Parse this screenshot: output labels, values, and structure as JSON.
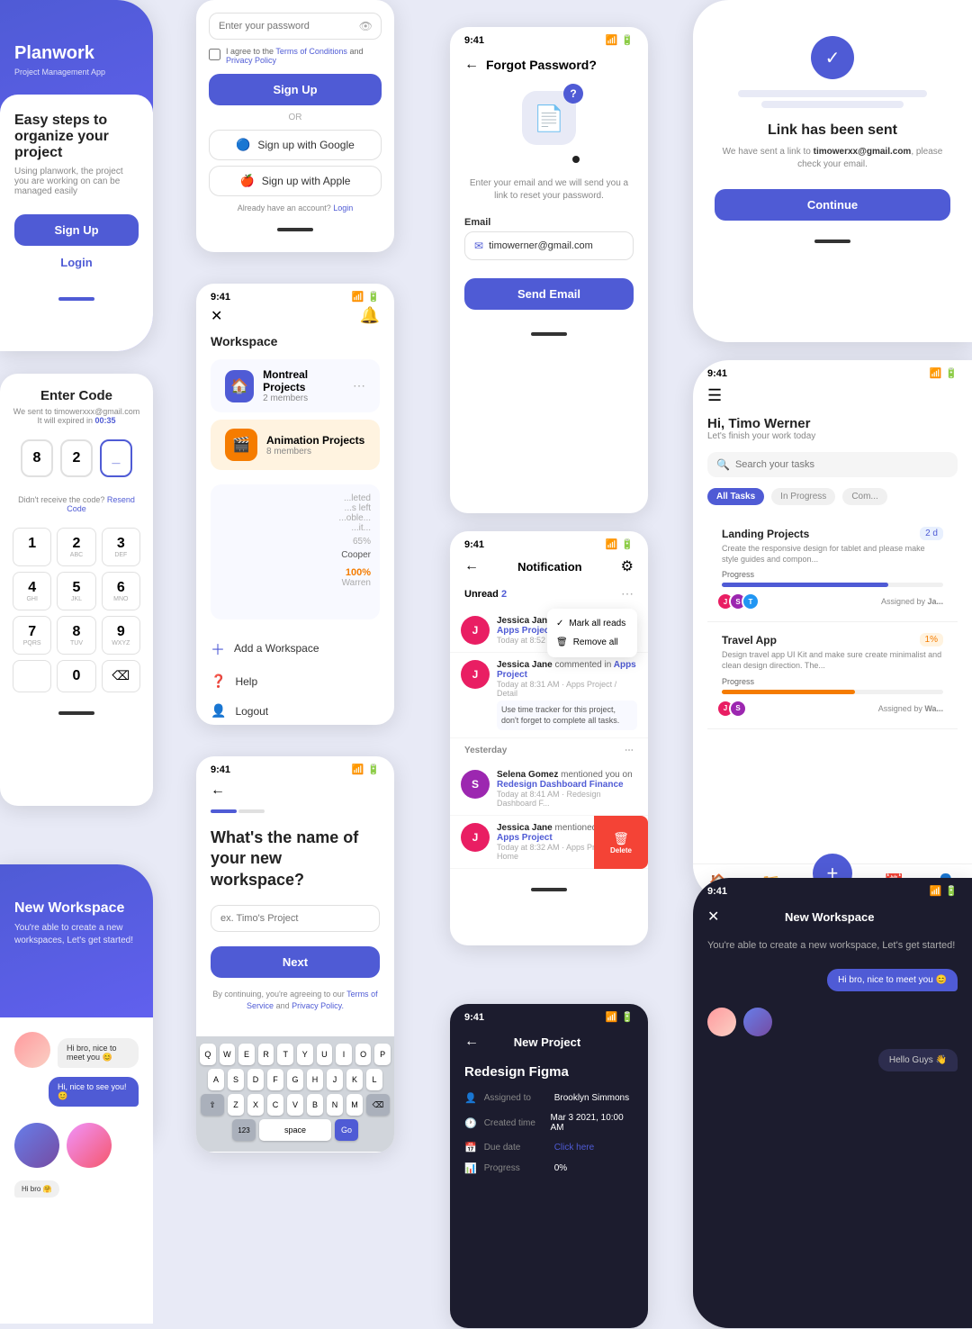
{
  "app": {
    "name": "Planwork",
    "tagline": "Project Management App",
    "description": "Easy steps to organize your project",
    "sub_description": "Using planwork, the project you are working on can be managed easily"
  },
  "signup": {
    "password_placeholder": "Enter your password",
    "terms_label": "I agree to the Terms of Conditions and Privacy Policy",
    "sign_up_btn": "Sign Up",
    "or_label": "OR",
    "google_btn": "Sign up with Google",
    "apple_btn": "Sign up with Apple",
    "login_prompt": "Already have an account?",
    "login_link": "Login"
  },
  "workspace": {
    "title": "Workspace",
    "projects": [
      {
        "name": "Montreal Projects",
        "members": "2 members",
        "color": "#4f5bd5"
      },
      {
        "name": "Animation Projects",
        "members": "8 members",
        "color": "#f57c00"
      }
    ],
    "add_workspace": "Add a Workspace",
    "help": "Help",
    "logout": "Logout"
  },
  "new_workspace_name": {
    "title": "What's the name of your new workspace?",
    "placeholder": "ex. Timo's Project",
    "next_btn": "Next",
    "terms_text": "By continuing, you're agreeing to our Terms of Service and Privacy Policy."
  },
  "enter_code": {
    "title": "Enter Code",
    "sent_to": "We sent to timowerxxx@gmail.com",
    "expiry": "It will expired in",
    "timer": "00:35",
    "digits": [
      "8",
      "2",
      "_"
    ],
    "resend_prompt": "Didn't receive the code?",
    "resend_link": "Resend Code"
  },
  "forgot_password": {
    "title": "Forgot Password?",
    "description": "Enter your email and we will send you a link to reset your password.",
    "email_label": "Email",
    "email_value": "timowerner@gmail.com",
    "send_btn": "Send Email"
  },
  "link_sent": {
    "title": "Link has been sent",
    "description": "We have sent a link to timowerxx@gmail.com, please check your email.",
    "continue_btn": "Continue"
  },
  "notification": {
    "title": "Notification",
    "unread_label": "Unread",
    "unread_count": "2",
    "mark_all": "Mark all reads",
    "remove_all": "Remove all",
    "items": [
      {
        "user": "Jessica Jane",
        "action": "mentioned you in",
        "target": "Apps Project",
        "time": "Today at 8:52 AM",
        "color": "#e91e63"
      },
      {
        "user": "Jessica Jane",
        "action": "commented in",
        "target": "Apps Project",
        "time": "Today at 8:31 AM · Apps Project / Detail",
        "message": "Use time tracker for this project, don't forget to complete all tasks.",
        "color": "#e91e63"
      }
    ],
    "yesterday_label": "Yesterday",
    "yesterday_items": [
      {
        "user": "Selena Gomez",
        "action": "mentioned you on",
        "target": "Redesign Dashboard Finance",
        "time": "Today at 8:41 AM · Redesign Dashboard F...",
        "color": "#9c27b0"
      },
      {
        "user": "Jessica Jane",
        "action": "mentioned you on",
        "target": "Apps Project",
        "time": "Today at 8:32 AM · Apps Project / Home",
        "color": "#e91e63"
      }
    ]
  },
  "task_manager": {
    "greeting": "Hi, Timo Werner",
    "sub_greeting": "Let's finish your work today",
    "search_placeholder": "Search your tasks",
    "tabs": [
      "All Tasks",
      "In Progress",
      "Com..."
    ],
    "tasks": [
      {
        "title": "Landing Projects",
        "badge": "2 d",
        "badge_color": "#4f5bd5",
        "description": "Create the responsive design for tablet and please make style guides and compon...",
        "progress": 75,
        "progress_color": "#4f5bd5",
        "assignees": [
          "#e91e63",
          "#9c27b0",
          "#2196f3"
        ]
      },
      {
        "title": "Travel App",
        "badge": "1%",
        "badge_color": "#f57c00",
        "description": "Design travel app UI Kit and make sure create minimalist and clean design direction. The...",
        "progress": 60,
        "progress_color": "#f57c00",
        "assignees": [
          "#e91e63",
          "#9c27b0"
        ]
      }
    ]
  },
  "new_project": {
    "title": "New Project",
    "project_name": "Redesign Figma",
    "assigned_to_label": "Assigned to",
    "assigned_to": "Brooklyn Simmons",
    "created_label": "Created time",
    "created": "Mar 3 2021, 10:00 AM",
    "due_label": "Due date",
    "due": "Click here",
    "progress_label": "Progress",
    "progress_value": "0%"
  },
  "new_workspace_splash": {
    "title": "New Workspace",
    "description": "You're able to create a new workspaces, Let's get started!"
  },
  "new_workspace_dark": {
    "title": "New Workspace",
    "description": "You're able to create a new workspace, Let's get started!",
    "chat1": "Hi bro, nice to meet you 😊",
    "chat2": "Hello Guys 👋"
  },
  "time": "9:41",
  "colors": {
    "primary": "#4f5bd5",
    "orange": "#f57c00",
    "pink": "#e91e63",
    "purple": "#9c27b0",
    "blue": "#2196f3"
  }
}
